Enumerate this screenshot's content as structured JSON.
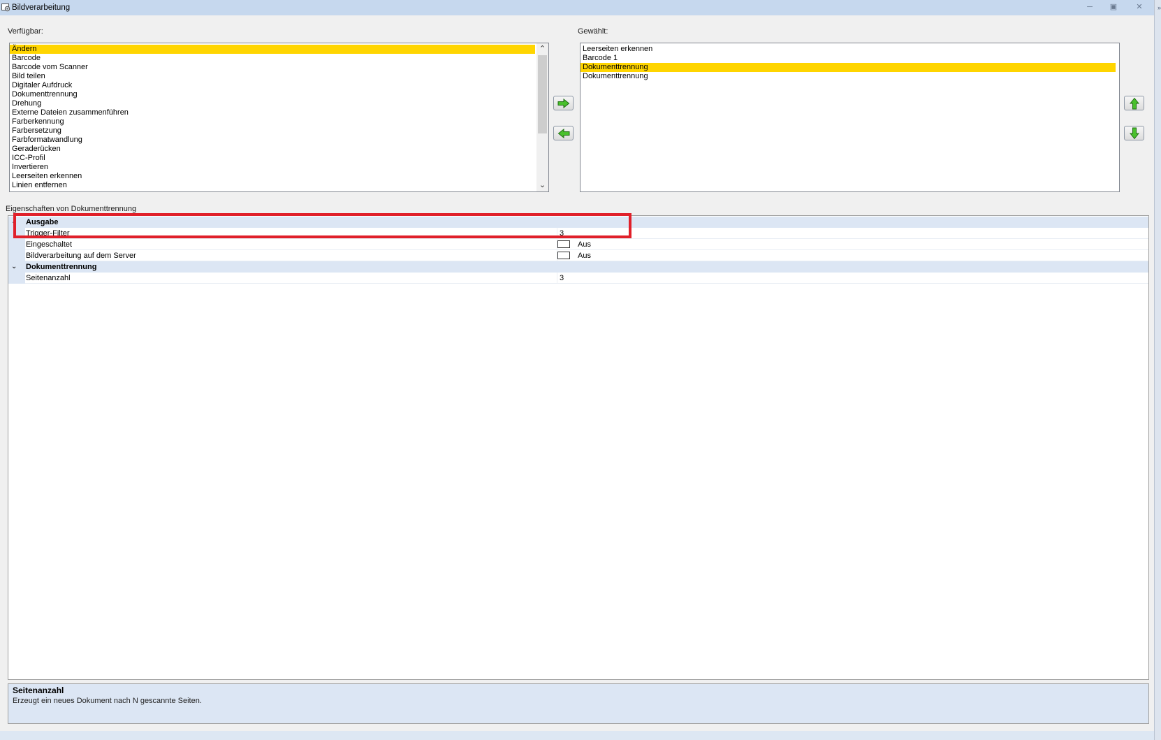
{
  "window": {
    "title": "Bildverarbeitung",
    "icon": "gear-image-icon",
    "controls": [
      "minimize-icon",
      "maximize-icon",
      "close-icon"
    ]
  },
  "available": {
    "label": "Verfügbar:",
    "items": [
      "Ändern",
      "Barcode",
      "Barcode vom Scanner",
      "Bild teilen",
      "Digitaler Aufdruck",
      "Dokumenttrennung",
      "Drehung",
      "Externe Dateien zusammenführen",
      "Farberkennung",
      "Farbersetzung",
      "Farbformatwandlung",
      "Geraderücken",
      "ICC-Profil",
      "Invertieren",
      "Leerseiten erkennen",
      "Linien entfernen"
    ],
    "selected_index": 0
  },
  "selected": {
    "label": "Gewählt:",
    "items": [
      "Leerseiten erkennen",
      "Barcode 1",
      "Dokumenttrennung",
      "Dokumenttrennung"
    ],
    "selected_index": 2
  },
  "buttons": {
    "add": "arrow-right-icon",
    "remove": "arrow-left-icon",
    "up": "arrow-up-icon",
    "down": "arrow-down-icon"
  },
  "properties": {
    "label": "Eigenschaften von Dokumenttrennung",
    "categories": [
      {
        "name": "Ausgabe",
        "rows": [
          {
            "name": "Trigger-Filter",
            "value": "3"
          },
          {
            "name": "Eingeschaltet",
            "value": "Aus"
          },
          {
            "name": "Bildverarbeitung auf dem Server",
            "value": "Aus"
          }
        ]
      },
      {
        "name": "Dokumenttrennung",
        "rows": [
          {
            "name": "Seitenanzahl",
            "value": "3"
          }
        ]
      }
    ]
  },
  "description": {
    "title": "Seitenanzahl",
    "text": "Erzeugt ein neues Dokument nach N gescannte Seiten."
  },
  "colors": {
    "selection": "#ffd500",
    "category_bg": "#dce6f4",
    "annotation": "#e0202a",
    "arrow_green": "#3cb521"
  }
}
